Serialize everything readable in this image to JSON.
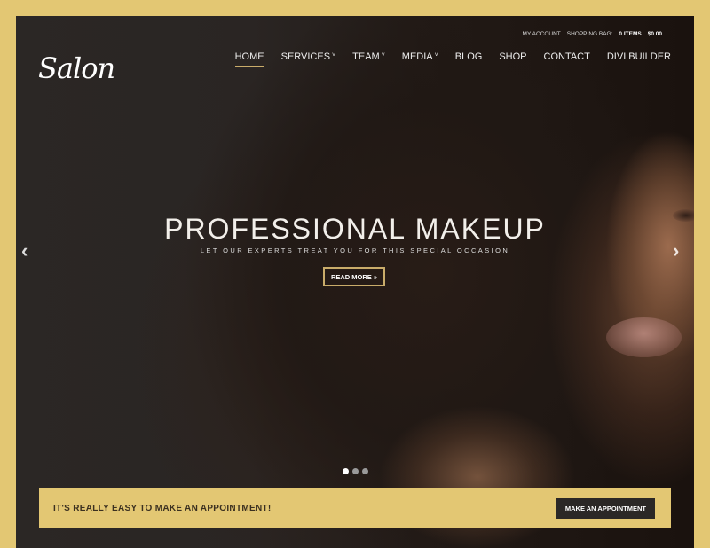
{
  "brand": {
    "logo": "Salon"
  },
  "topbar": {
    "account": "My Account",
    "bag": "Shopping Bag:",
    "items": "0 Items",
    "total": "$0.00"
  },
  "nav": {
    "items": [
      {
        "label": "HOME",
        "active": true,
        "dropdown": false
      },
      {
        "label": "SERVICES",
        "dropdown": true
      },
      {
        "label": "TEAM",
        "dropdown": true
      },
      {
        "label": "MEDIA",
        "dropdown": true
      },
      {
        "label": "BLOG",
        "dropdown": false
      },
      {
        "label": "SHOP",
        "dropdown": false
      },
      {
        "label": "CONTACT",
        "dropdown": false
      },
      {
        "label": "DIVI BUILDER",
        "dropdown": false
      }
    ],
    "chevron": "˅"
  },
  "hero": {
    "title": "PROFESSIONAL MAKEUP",
    "subtitle": "Let our experts treat you for this special occasion",
    "button": "READ MORE »",
    "prev_icon": "‹",
    "next_icon": "›",
    "slides": 3,
    "active_slide": 1
  },
  "cta": {
    "text": "IT'S REALLY EASY TO MAKE AN APPOINTMENT!",
    "button": "MAKE AN APPOINTMENT"
  },
  "colors": {
    "accent": "#e3c773",
    "dark": "#2a2624",
    "gold_line": "#c9ac6a"
  }
}
